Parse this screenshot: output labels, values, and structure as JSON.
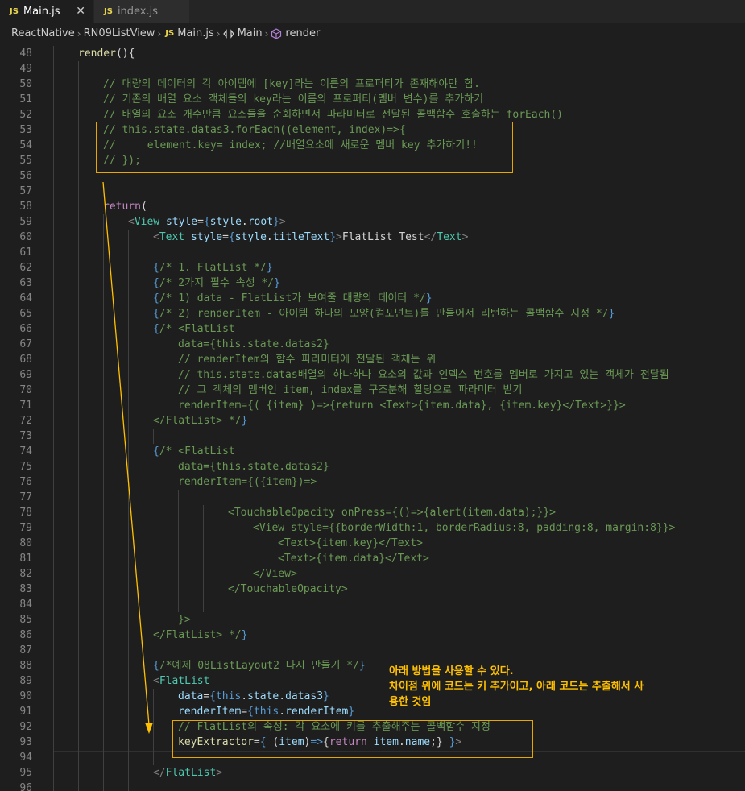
{
  "tabs": [
    {
      "badge": "JS",
      "label": "Main.js",
      "close": "✕"
    },
    {
      "badge": "JS",
      "label": "index.js"
    }
  ],
  "breadcrumb": {
    "items": [
      "ReactNative",
      "RN09ListView",
      "Main.js",
      "Main",
      "render"
    ],
    "badge": "JS",
    "sep": "›"
  },
  "annotation": {
    "line1": "아래 방법을 사용할 수 있다.",
    "line2": "차이점 위에 코드는 키 추가이고, 아래 코드는 추출해서 사",
    "line3": "용한 것임"
  },
  "colors": {
    "highlight": "#e8a600",
    "annotation": "#ffc000"
  },
  "lines": [
    {
      "n": "48",
      "indent": 2,
      "t": [
        [
          "fn",
          "render"
        ],
        [
          "txt",
          "(){"
        ]
      ]
    },
    {
      "n": "49",
      "indent": 0,
      "t": []
    },
    {
      "n": "50",
      "indent": 4,
      "t": [
        [
          "cm",
          "// 대량의 데이터의 각 아이템에 [key]라는 이름의 프로퍼티가 존재해야만 함."
        ]
      ]
    },
    {
      "n": "51",
      "indent": 4,
      "t": [
        [
          "cm",
          "// 기존의 배열 요소 객체들의 key라는 이름의 프로퍼티(멤버 변수)를 추가하기"
        ]
      ]
    },
    {
      "n": "52",
      "indent": 4,
      "t": [
        [
          "cm",
          "// 배열의 요소 개수만큼 요소들을 순회하면서 파라미터로 전달된 콜백함수 호출하는 forEach()"
        ]
      ]
    },
    {
      "n": "53",
      "indent": 4,
      "t": [
        [
          "cm",
          "// this.state.datas3.forEach((element, index)=>{"
        ]
      ]
    },
    {
      "n": "54",
      "indent": 4,
      "t": [
        [
          "cm",
          "//     element.key= index; //배열요소에 새로운 멤버 key 추가하기!!"
        ]
      ]
    },
    {
      "n": "55",
      "indent": 4,
      "t": [
        [
          "cm",
          "// });"
        ]
      ]
    },
    {
      "n": "56",
      "indent": 0,
      "t": []
    },
    {
      "n": "57",
      "indent": 0,
      "t": []
    },
    {
      "n": "58",
      "indent": 4,
      "t": [
        [
          "kw",
          "return"
        ],
        [
          "txt",
          "("
        ]
      ]
    },
    {
      "n": "59",
      "indent": 6,
      "t": [
        [
          "punc",
          "<"
        ],
        [
          "tag",
          "View"
        ],
        [
          "txt",
          " "
        ],
        [
          "attr",
          "style"
        ],
        [
          "txt",
          "="
        ],
        [
          "brace",
          "{"
        ],
        [
          "var",
          "style"
        ],
        [
          "txt",
          "."
        ],
        [
          "var",
          "root"
        ],
        [
          "brace",
          "}"
        ],
        [
          "punc",
          ">"
        ]
      ]
    },
    {
      "n": "60",
      "indent": 8,
      "t": [
        [
          "punc",
          "<"
        ],
        [
          "tag",
          "Text"
        ],
        [
          "txt",
          " "
        ],
        [
          "attr",
          "style"
        ],
        [
          "txt",
          "="
        ],
        [
          "brace",
          "{"
        ],
        [
          "var",
          "style"
        ],
        [
          "txt",
          "."
        ],
        [
          "var",
          "titleText"
        ],
        [
          "brace",
          "}"
        ],
        [
          "punc",
          ">"
        ],
        [
          "txt",
          "FlatList Test"
        ],
        [
          "punc",
          "</"
        ],
        [
          "tag",
          "Text"
        ],
        [
          "punc",
          ">"
        ]
      ]
    },
    {
      "n": "61",
      "indent": 0,
      "t": []
    },
    {
      "n": "62",
      "indent": 8,
      "t": [
        [
          "brace",
          "{"
        ],
        [
          "cm",
          "/* 1. FlatList */"
        ],
        [
          "brace",
          "}"
        ]
      ]
    },
    {
      "n": "63",
      "indent": 8,
      "t": [
        [
          "brace",
          "{"
        ],
        [
          "cm",
          "/* 2가지 필수 속성 */"
        ],
        [
          "brace",
          "}"
        ]
      ]
    },
    {
      "n": "64",
      "indent": 8,
      "t": [
        [
          "brace",
          "{"
        ],
        [
          "cm",
          "/* 1) data - FlatList가 보여줄 대량의 데이터 */"
        ],
        [
          "brace",
          "}"
        ]
      ]
    },
    {
      "n": "65",
      "indent": 8,
      "t": [
        [
          "brace",
          "{"
        ],
        [
          "cm",
          "/* 2) renderItem - 아이템 하나의 모양(컴포넌트)를 만들어서 리턴하는 콜백함수 지정 */"
        ],
        [
          "brace",
          "}"
        ]
      ]
    },
    {
      "n": "66",
      "indent": 8,
      "t": [
        [
          "brace",
          "{"
        ],
        [
          "cm",
          "/* <FlatList"
        ]
      ]
    },
    {
      "n": "67",
      "indent": 10,
      "t": [
        [
          "cm",
          "data={this.state.datas2}"
        ]
      ]
    },
    {
      "n": "68",
      "indent": 10,
      "t": [
        [
          "cm",
          "// renderItem의 함수 파라미터에 전달된 객체는 위"
        ]
      ]
    },
    {
      "n": "69",
      "indent": 10,
      "t": [
        [
          "cm",
          "// this.state.datas배열의 하나하나 요소의 값과 인덱스 번호를 멤버로 가지고 있는 객체가 전달됨"
        ]
      ]
    },
    {
      "n": "70",
      "indent": 10,
      "t": [
        [
          "cm",
          "// 그 객체의 멤버인 item, index를 구조분해 할당으로 파라미터 받기"
        ]
      ]
    },
    {
      "n": "71",
      "indent": 10,
      "t": [
        [
          "cm",
          "renderItem={( {item} )=>{return <Text>{item.data}, {item.key}</Text>}}>"
        ]
      ]
    },
    {
      "n": "72",
      "indent": 8,
      "t": [
        [
          "cm",
          "</FlatList> */"
        ],
        [
          "brace",
          "}"
        ]
      ]
    },
    {
      "n": "73",
      "indent": 0,
      "t": []
    },
    {
      "n": "74",
      "indent": 8,
      "t": [
        [
          "brace",
          "{"
        ],
        [
          "cm",
          "/* <FlatList"
        ]
      ]
    },
    {
      "n": "75",
      "indent": 10,
      "t": [
        [
          "cm",
          "data={this.state.datas2}"
        ]
      ]
    },
    {
      "n": "76",
      "indent": 10,
      "t": [
        [
          "cm",
          "renderItem={({item})=>"
        ]
      ]
    },
    {
      "n": "77",
      "indent": 0,
      "t": []
    },
    {
      "n": "78",
      "indent": 14,
      "t": [
        [
          "cm",
          "<TouchableOpacity onPress={()=>{alert(item.data);}}>"
        ]
      ]
    },
    {
      "n": "79",
      "indent": 16,
      "t": [
        [
          "cm",
          "<View style={{borderWidth:1, borderRadius:8, padding:8, margin:8}}>"
        ]
      ]
    },
    {
      "n": "80",
      "indent": 18,
      "t": [
        [
          "cm",
          "<Text>{item.key}</Text>"
        ]
      ]
    },
    {
      "n": "81",
      "indent": 18,
      "t": [
        [
          "cm",
          "<Text>{item.data}</Text>"
        ]
      ]
    },
    {
      "n": "82",
      "indent": 16,
      "t": [
        [
          "cm",
          "</View>"
        ]
      ]
    },
    {
      "n": "83",
      "indent": 14,
      "t": [
        [
          "cm",
          "</TouchableOpacity>"
        ]
      ]
    },
    {
      "n": "84",
      "indent": 0,
      "t": []
    },
    {
      "n": "85",
      "indent": 10,
      "t": [
        [
          "cm",
          "}>"
        ]
      ]
    },
    {
      "n": "86",
      "indent": 8,
      "t": [
        [
          "cm",
          "</FlatList> */"
        ],
        [
          "brace",
          "}"
        ]
      ]
    },
    {
      "n": "87",
      "indent": 0,
      "t": []
    },
    {
      "n": "88",
      "indent": 8,
      "t": [
        [
          "brace",
          "{"
        ],
        [
          "cm",
          "/*예제 08ListLayout2 다시 만들기 */"
        ],
        [
          "brace",
          "}"
        ]
      ]
    },
    {
      "n": "89",
      "indent": 8,
      "t": [
        [
          "punc",
          "<"
        ],
        [
          "tag",
          "FlatList"
        ]
      ]
    },
    {
      "n": "90",
      "indent": 10,
      "t": [
        [
          "attr",
          "data"
        ],
        [
          "txt",
          "="
        ],
        [
          "brace",
          "{"
        ],
        [
          "brace",
          "this"
        ],
        [
          "txt",
          "."
        ],
        [
          "var",
          "state"
        ],
        [
          "txt",
          "."
        ],
        [
          "var",
          "datas3"
        ],
        [
          "brace",
          "}"
        ]
      ]
    },
    {
      "n": "91",
      "indent": 10,
      "t": [
        [
          "attr",
          "renderItem"
        ],
        [
          "txt",
          "="
        ],
        [
          "brace",
          "{"
        ],
        [
          "brace",
          "this"
        ],
        [
          "txt",
          "."
        ],
        [
          "var",
          "renderItem"
        ],
        [
          "brace",
          "}"
        ]
      ]
    },
    {
      "n": "92",
      "indent": 10,
      "t": [
        [
          "cm",
          "// FlatList의 속성: 각 요소에 키를 추출해주는 콜백함수 지정"
        ]
      ]
    },
    {
      "n": "93",
      "indent": 10,
      "t": [
        [
          "fn",
          "keyExtractor"
        ],
        [
          "txt",
          "="
        ],
        [
          "brace",
          "{"
        ],
        [
          "txt",
          " ("
        ],
        [
          "var",
          "item"
        ],
        [
          "txt",
          ")"
        ],
        [
          "brace",
          "=>"
        ],
        [
          "txt",
          "{"
        ],
        [
          "kw",
          "return"
        ],
        [
          "txt",
          " "
        ],
        [
          "var",
          "item"
        ],
        [
          "txt",
          "."
        ],
        [
          "var",
          "name"
        ],
        [
          "txt",
          ";} "
        ],
        [
          "brace",
          "}"
        ],
        [
          "punc",
          ">"
        ]
      ]
    },
    {
      "n": "94",
      "indent": 0,
      "t": []
    },
    {
      "n": "95",
      "indent": 8,
      "t": [
        [
          "punc",
          "</"
        ],
        [
          "tag",
          "FlatList"
        ],
        [
          "punc",
          ">"
        ]
      ]
    },
    {
      "n": "96",
      "indent": 0,
      "t": []
    }
  ]
}
